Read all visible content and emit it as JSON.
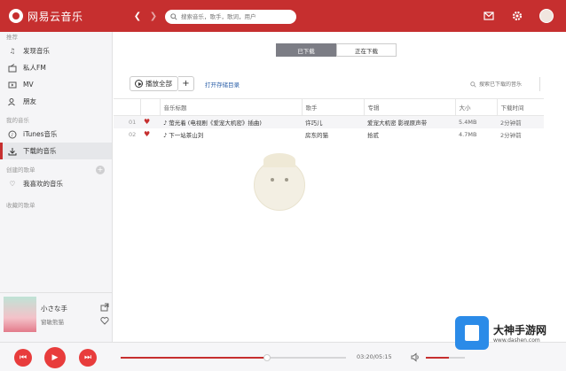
{
  "app": {
    "name": "网易云音乐"
  },
  "search": {
    "placeholder": "搜索音乐，歌手，歌词，用户"
  },
  "sidebar": {
    "recommend_head": "推荐",
    "items": [
      {
        "label": "发现音乐",
        "icon": "music-note-icon"
      },
      {
        "label": "私人FM",
        "icon": "radio-icon"
      },
      {
        "label": "MV",
        "icon": "mv-icon"
      },
      {
        "label": "朋友",
        "icon": "friends-icon"
      }
    ],
    "my_music_head": "我的音乐",
    "my_items": [
      {
        "label": "iTunes音乐",
        "icon": "itunes-icon"
      },
      {
        "label": "下载的音乐",
        "icon": "download-icon"
      }
    ],
    "created_head": "创建的歌单",
    "created_items": [
      {
        "label": "我喜欢的音乐",
        "icon": "heart-icon"
      }
    ],
    "collected_head": "收藏的歌单"
  },
  "now_playing": {
    "title": "小さな手",
    "artist": "窗敏熊猫"
  },
  "tabs": [
    {
      "label": "已下载"
    },
    {
      "label": "正在下载"
    }
  ],
  "toolbar": {
    "play_all": "播放全部",
    "add": "+",
    "open_dir": "打开存储目录"
  },
  "local_search": {
    "placeholder": "搜索已下载的音乐"
  },
  "table": {
    "headers": [
      "",
      "",
      "音乐标题",
      "歌手",
      "专辑",
      "大小",
      "下载时间"
    ],
    "rows": [
      {
        "idx": "01",
        "title": "萤光着 (电视剧《爱宠大机密》插曲)",
        "artist": "许巧儿",
        "album": "爱宠大机密 影视原声带",
        "size": "5.4MB",
        "time": "2分钟前"
      },
      {
        "idx": "02",
        "title": "下一站茶山刘",
        "artist": "房东的猫",
        "album": "拾贰",
        "size": "4.7MB",
        "time": "2分钟前"
      }
    ]
  },
  "player": {
    "time": "03:20/05:15",
    "progress": 0.65,
    "volume": 0.6
  },
  "watermark": {
    "title": "大神手游网",
    "url": "www.dashen.com"
  },
  "colors": {
    "accent": "#c62f2f",
    "sidebar_bg": "#f5f5f7"
  }
}
